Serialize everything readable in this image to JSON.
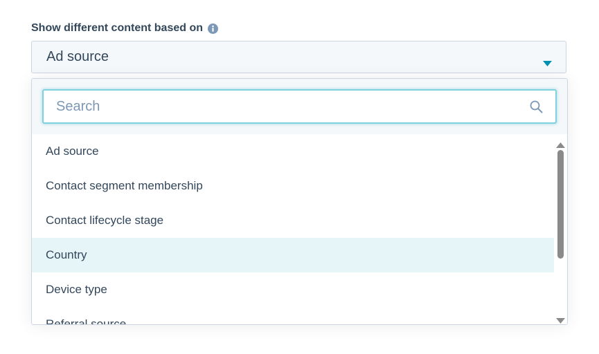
{
  "label": {
    "text": "Show different content based on",
    "info_icon": "info-circle-icon"
  },
  "select": {
    "value": "Ad source",
    "caret_icon": "caret-down-icon"
  },
  "search": {
    "placeholder": "Search",
    "value": "",
    "icon": "search-icon"
  },
  "options": [
    {
      "label": "Ad source"
    },
    {
      "label": "Contact segment membership"
    },
    {
      "label": "Contact lifecycle stage"
    },
    {
      "label": "Country",
      "highlighted": true
    },
    {
      "label": "Device type"
    },
    {
      "label": "Referral source"
    }
  ],
  "scrollbar": {
    "up_icon": "scroll-up-arrow-icon",
    "down_icon": "scroll-down-arrow-icon"
  },
  "colors": {
    "text": "#33475b",
    "accent": "#00a4bd",
    "trigger_bg": "#f5f8fa",
    "highlight_bg": "#e5f5f8",
    "border": "#cbd6e2"
  }
}
